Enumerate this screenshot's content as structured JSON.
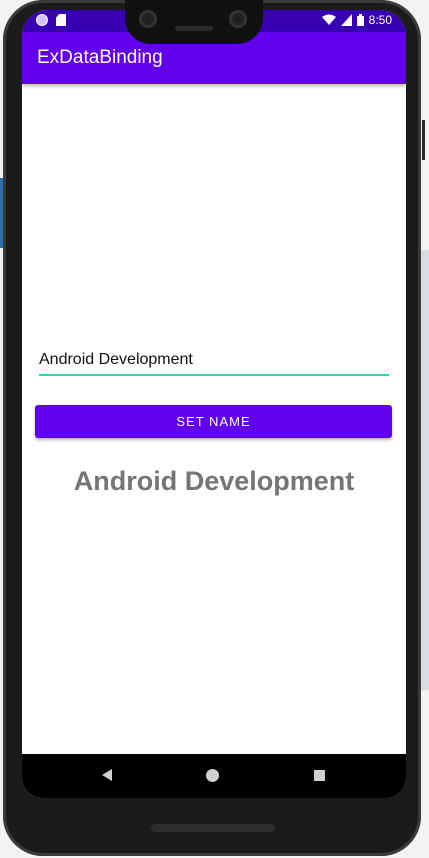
{
  "status_bar": {
    "time": "8:50",
    "icons": [
      "notification-circle-icon",
      "sd-card-icon",
      "wifi-icon",
      "signal-icon",
      "battery-icon"
    ]
  },
  "app_bar": {
    "title": "ExDataBinding"
  },
  "form": {
    "name_value": "Android Development",
    "set_name_label": "SET NAME"
  },
  "display": {
    "name_text": "Android Development"
  },
  "nav_bar": {
    "icons": [
      "back-icon",
      "home-icon",
      "recents-icon"
    ]
  },
  "colors": {
    "primary": "#6200ee",
    "primary_dark": "#3700b3",
    "accent": "#2ed4b6",
    "display_text": "#757575"
  }
}
